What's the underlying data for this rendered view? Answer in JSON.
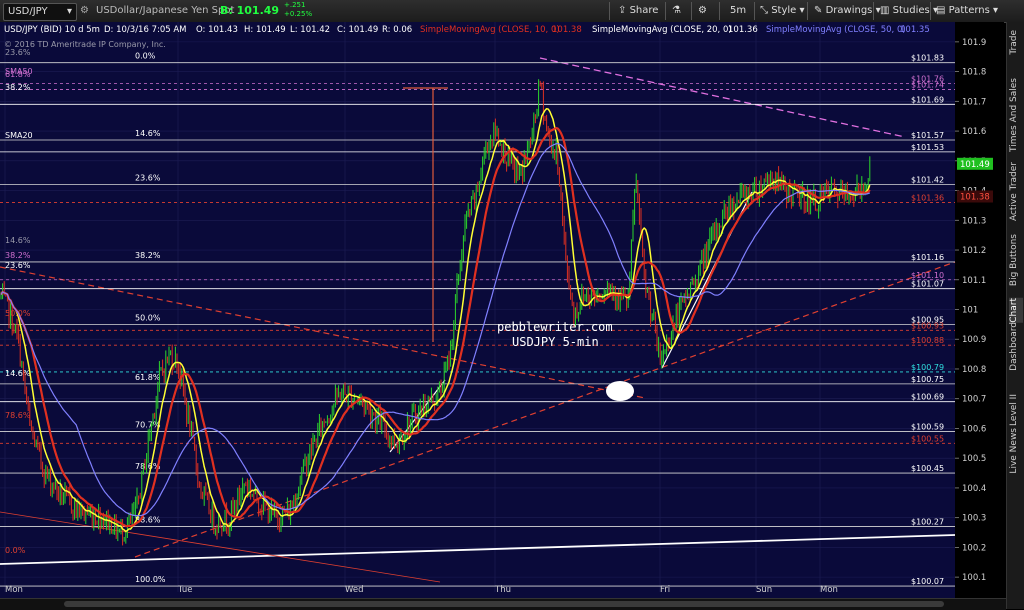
{
  "toolbar": {
    "symbol": "USD/JPY",
    "description": "USDollar/Japanese Yen Spot",
    "bid_label": "B: 101.49",
    "change_up": "+.251",
    "change_pct": "+0.25%",
    "share": "Share",
    "timeframe": "5m",
    "style": "Style",
    "drawings": "Drawings",
    "studies": "Studies",
    "patterns": "Patterns"
  },
  "header": {
    "symbol_info": "USD/JPY (BID) 10 d 5m",
    "date": "D: 10/3/16 7:05 AM",
    "open": "O: 101.43",
    "high": "H: 101.49",
    "low": "L: 101.42",
    "close": "C: 101.49",
    "range": "R: 0.06",
    "sma10": "SimpleMovingAvg (CLOSE, 10, 0)",
    "sma10_val": "101.38",
    "sma20": "SimpleMovingAvg (CLOSE, 20, 0)",
    "sma20_val": "101.36",
    "sma50": "SimpleMovingAvg (CLOSE, 50, 0)",
    "sma50_val": "101.35",
    "copyright": "© 2016 TD Ameritrade IP Company, Inc."
  },
  "annotations": {
    "line1": "pebblewriter.com",
    "line2": "USDJPY 5-min",
    "sma50_label": "SMA50",
    "sma20_label": "SMA20"
  },
  "chart_data": {
    "type": "line",
    "symbol": "USD/JPY",
    "x_labels": [
      "Mon",
      "Tue",
      "Wed",
      "Thu",
      "Fri",
      "Sun",
      "Mon"
    ],
    "ylim": [
      100.05,
      101.95
    ],
    "y_ticks": [
      100.1,
      100.2,
      100.3,
      100.4,
      100.5,
      100.6,
      100.7,
      100.8,
      100.9,
      101,
      101.1,
      101.2,
      101.3,
      101.4,
      101.5,
      101.6,
      101.7,
      101.8,
      101.9
    ],
    "y_tick_labels": [
      "100.1",
      "100.2",
      "100.3",
      "100.4",
      "100.5",
      "100.6",
      "100.7",
      "100.8",
      "100.9",
      "101",
      "101.1",
      "101.2",
      "101.3",
      "101.4",
      "101.5",
      "101.6",
      "101.7",
      "101.8",
      "101.9"
    ],
    "last_price": 101.49,
    "last_price_label": "101.49",
    "sma_label_value": "101.38",
    "series": [
      {
        "name": "SimpleMovingAvg (CLOSE, 10, 0)",
        "color": "#ffff33"
      },
      {
        "name": "SimpleMovingAvg (CLOSE, 20, 0)",
        "color": "#e03020"
      },
      {
        "name": "SimpleMovingAvg (CLOSE, 50, 0)",
        "color": "#8080ff"
      }
    ],
    "fib_levels": [
      {
        "label": "0.0%",
        "price": 101.83,
        "text": "$101.83"
      },
      {
        "label": "14.6%",
        "price": 101.57,
        "text": "$101.57"
      },
      {
        "label": "23.6%",
        "price": 101.42,
        "text": "$101.42"
      },
      {
        "label": "38.2%",
        "price": 101.16,
        "text": "$101.16"
      },
      {
        "label": "50.0%",
        "price": 100.95,
        "text": "$100.95"
      },
      {
        "label": "61.8%",
        "price": 100.75,
        "text": "$100.75"
      },
      {
        "label": "70.7%",
        "price": 100.59,
        "text": "$100.59"
      },
      {
        "label": "78.6%",
        "price": 100.45,
        "text": "$100.45"
      },
      {
        "label": "88.6%",
        "price": 100.27,
        "text": "$100.27"
      },
      {
        "label": "100.0%",
        "price": 100.07,
        "text": "$100.07"
      }
    ],
    "extra_levels": [
      {
        "price": 101.76,
        "text": "$101.76",
        "color": "#d070d0"
      },
      {
        "price": 101.74,
        "text": "$101.74",
        "color": "#d070d0"
      },
      {
        "price": 101.69,
        "text": "$101.69",
        "color": "#ffffff"
      },
      {
        "price": 101.53,
        "text": "$101.53",
        "color": "#ffffff"
      },
      {
        "price": 101.36,
        "text": "$101.36",
        "color": "#e04030"
      },
      {
        "price": 101.1,
        "text": "$101.10",
        "color": "#d070d0"
      },
      {
        "price": 101.07,
        "text": "$101.07",
        "color": "#ffffff"
      },
      {
        "price": 100.93,
        "text": "$100.93",
        "color": "#e04030"
      },
      {
        "price": 100.88,
        "text": "$100.88",
        "color": "#e04030"
      },
      {
        "price": 100.79,
        "text": "$100.79",
        "color": "#30e0e0"
      },
      {
        "price": 100.69,
        "text": "$100.69",
        "color": "#ffffff"
      },
      {
        "price": 100.55,
        "text": "$100.55",
        "color": "#e04030"
      }
    ],
    "left_fib_labels": [
      "23.6%",
      "61.8%",
      "38.2%",
      "14.6%",
      "38.2%",
      "23.6%",
      "50.0%",
      "14.6%",
      "78.6%",
      "0.0%"
    ]
  },
  "right_tabs": [
    "Trade",
    "Times And Sales",
    "Active Trader",
    "Big Buttons",
    "Chart",
    "Dashboard",
    "Level II",
    "Live News"
  ]
}
